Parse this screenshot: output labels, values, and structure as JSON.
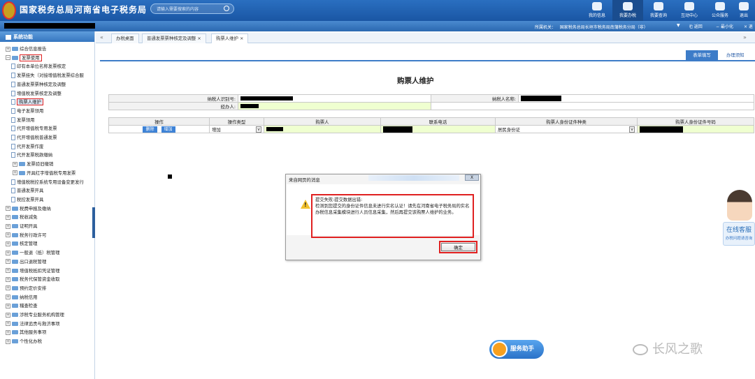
{
  "header": {
    "title": "国家税务总局河南省电子税务局",
    "search_placeholder": "请输入需要搜索的内容",
    "nav": [
      "我的信息",
      "我要办税",
      "我要查询",
      "互动中心",
      "公众服务",
      "退出"
    ]
  },
  "status_bar": {
    "org_label": "所属机关：",
    "org_value": "国家税务总局长垣市税务局南蒲税务分局",
    "org_suffix": "（非）",
    "back": "返回",
    "minimize": "最小化"
  },
  "sidebar": {
    "title": "系统功能",
    "items": [
      {
        "label": "综合信息报告",
        "level": 0,
        "type": "folder",
        "toggle": "+"
      },
      {
        "label": "发票使用",
        "level": 0,
        "type": "folder",
        "toggle": "−",
        "highlighted": true
      },
      {
        "label": "印有本单位名称发票核定",
        "level": 1,
        "type": "doc"
      },
      {
        "label": "发票挂失（对接增值税发票综合服",
        "level": 1,
        "type": "doc"
      },
      {
        "label": "普通发票票种核定及调整",
        "level": 1,
        "type": "doc"
      },
      {
        "label": "增值税发票核定及调整",
        "level": 1,
        "type": "doc"
      },
      {
        "label": "购票人维护",
        "level": 1,
        "type": "doc",
        "highlighted": true,
        "active": true
      },
      {
        "label": "电子发票领用",
        "level": 1,
        "type": "doc"
      },
      {
        "label": "发票领用",
        "level": 1,
        "type": "doc"
      },
      {
        "label": "代开增值税专用发票",
        "level": 1,
        "type": "doc"
      },
      {
        "label": "代开增值税普通发票",
        "level": 1,
        "type": "doc"
      },
      {
        "label": "代开发票作废",
        "level": 1,
        "type": "doc"
      },
      {
        "label": "代开发票税款缴纳",
        "level": 1,
        "type": "doc"
      },
      {
        "label": "发票验旧缴销",
        "level": 1,
        "type": "folder",
        "toggle": "+"
      },
      {
        "label": "开具红字增值税专用发票",
        "level": 1,
        "type": "folder",
        "toggle": "+"
      },
      {
        "label": "增值税税控系统专用设备变更发行",
        "level": 1,
        "type": "doc"
      },
      {
        "label": "普通发票开具",
        "level": 1,
        "type": "doc"
      },
      {
        "label": "税控发票开具",
        "level": 1,
        "type": "doc"
      },
      {
        "label": "税费申报及缴纳",
        "level": 0,
        "type": "folder",
        "toggle": "+"
      },
      {
        "label": "税收减免",
        "level": 0,
        "type": "folder",
        "toggle": "+"
      },
      {
        "label": "证明开具",
        "level": 0,
        "type": "folder",
        "toggle": "+"
      },
      {
        "label": "税务行政许可",
        "level": 0,
        "type": "folder",
        "toggle": "+"
      },
      {
        "label": "核定管理",
        "level": 0,
        "type": "folder",
        "toggle": "+"
      },
      {
        "label": "一般退（抵）税管理",
        "level": 0,
        "type": "folder",
        "toggle": "+"
      },
      {
        "label": "出口退税管理",
        "level": 0,
        "type": "folder",
        "toggle": "+"
      },
      {
        "label": "增值税抵扣凭证管理",
        "level": 0,
        "type": "folder",
        "toggle": "+"
      },
      {
        "label": "税务代保管资金收取",
        "level": 0,
        "type": "folder",
        "toggle": "+"
      },
      {
        "label": "预约定价安排",
        "level": 0,
        "type": "folder",
        "toggle": "+"
      },
      {
        "label": "纳税信用",
        "level": 0,
        "type": "folder",
        "toggle": "+"
      },
      {
        "label": "稽查检查",
        "level": 0,
        "type": "folder",
        "toggle": "+"
      },
      {
        "label": "涉税专业服务机构管理",
        "level": 0,
        "type": "folder",
        "toggle": "+"
      },
      {
        "label": "法律追责与救济事项",
        "level": 0,
        "type": "folder",
        "toggle": "+"
      },
      {
        "label": "其他服务事项",
        "level": 0,
        "type": "folder",
        "toggle": "+"
      },
      {
        "label": "个性化办税",
        "level": 0,
        "type": "folder",
        "toggle": "+"
      }
    ]
  },
  "tabs": [
    "办税桌面",
    "普通发票票种核定及调整",
    "购票人维护"
  ],
  "tab_close": "×",
  "content": {
    "btn_form": "表单填写",
    "btn_guide": "办理须知",
    "page_title": "购票人维护",
    "taxpayer_id_label": "纳税人识别号:",
    "taxpayer_name_label": "纳税人名称:",
    "handler_label": "经办人:",
    "columns": [
      "操作",
      "操作类型",
      "购票人",
      "联系电话",
      "购票人身份证件种类",
      "购票人身份证件号码"
    ],
    "row": {
      "delete_btn": "删除",
      "add_btn": "增加",
      "op_type": "增加",
      "id_type": "居民身份证"
    }
  },
  "dialog": {
    "title": "来自网页的消息",
    "close": "X",
    "message_line1": "提交失败:提交数据出错:",
    "message_line2": "检测到您提交的身份证件信息未进行实名认证！请先在河南省电子税务局的实名办税信息采集模块进行人员信息采集，然后再提交该购票人维护的业务。",
    "ok": "确定"
  },
  "customer_service": {
    "label": "在线客服",
    "sub": "办税问题请咨询"
  },
  "assistant": "服务助手",
  "watermark": "长风之歌",
  "colors": {
    "header_blue": "#1a56a4",
    "accent_blue": "#3d7cc8",
    "highlight_red": "#e02020",
    "input_green": "#efffd0"
  }
}
